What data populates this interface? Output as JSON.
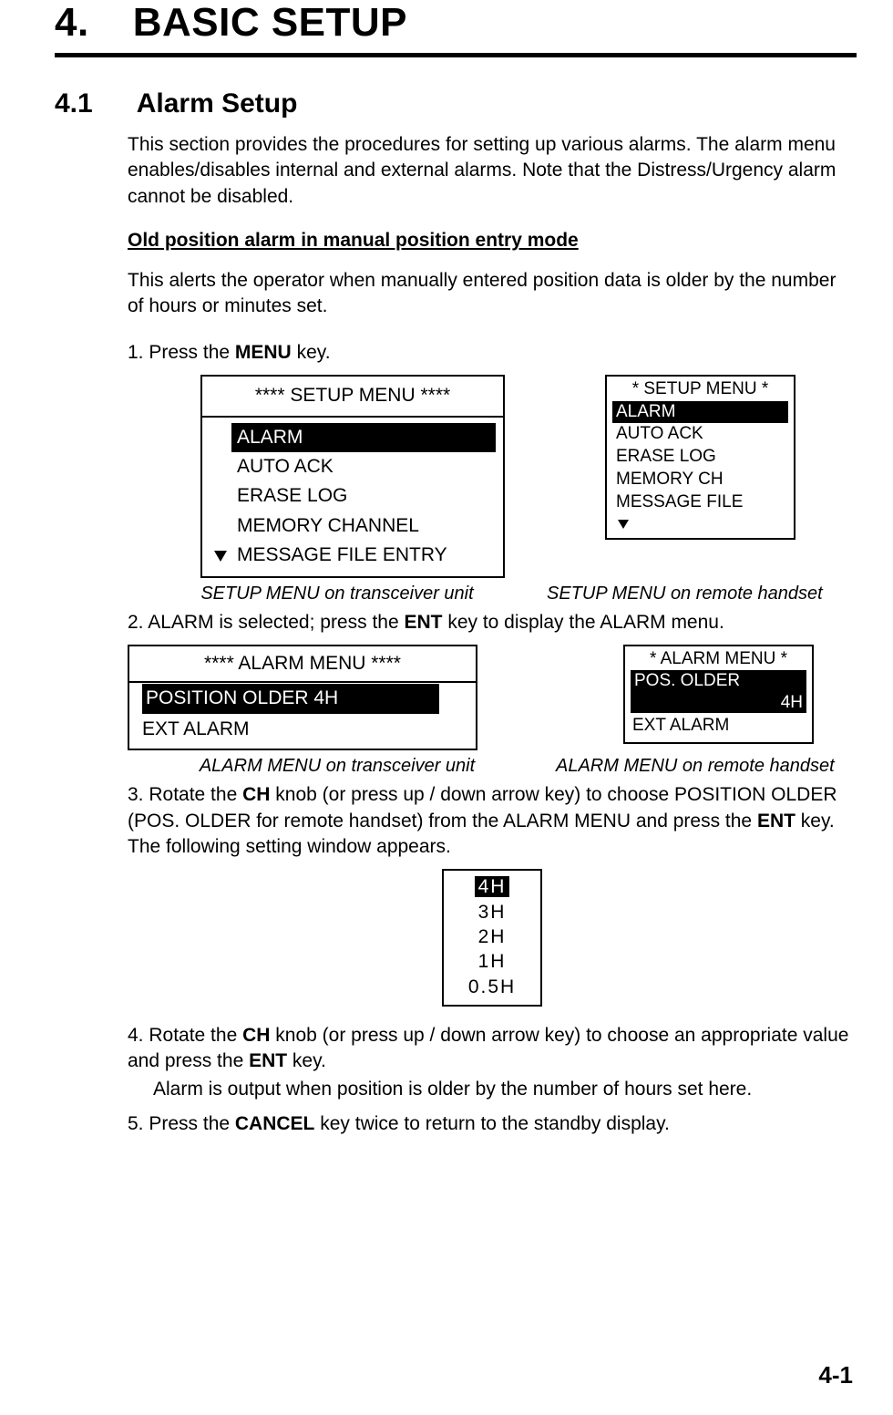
{
  "chapter": {
    "num": "4.",
    "title": "BASIC SETUP"
  },
  "section": {
    "num": "4.1",
    "title": "Alarm Setup"
  },
  "intro": "This section provides the procedures for setting up various alarms. The alarm menu enables/disables internal and external alarms. Note that the Distress/Urgency alarm cannot be disabled.",
  "sub1": "Old position alarm in manual position entry mode",
  "sub1_body": "This alerts the operator when manually entered position data is older by the number of hours or minutes set.",
  "step1_a": "1. Press the ",
  "step1_b": "MENU",
  "step1_c": " key.",
  "setup_big": {
    "header": "**** SETUP MENU ****",
    "items": [
      "ALARM",
      "AUTO  ACK",
      "ERASE  LOG",
      "MEMORY CHANNEL",
      "MESSAGE FILE ENTRY"
    ]
  },
  "setup_small": {
    "header": "* SETUP MENU *",
    "items": [
      "ALARM",
      "AUTO  ACK",
      "ERASE  LOG",
      "MEMORY CH",
      "MESSAGE FILE"
    ]
  },
  "caption1_left": "SETUP MENU on transceiver unit",
  "caption1_right": "SETUP MENU on remote handset",
  "step2_a": "2. ALARM is selected; press the ",
  "step2_b": "ENT",
  "step2_c": " key to display the ALARM menu.",
  "alarm_big": {
    "header": "**** ALARM MENU ****",
    "row1": "POSITION  OLDER   4H",
    "row2": "EXT ALARM"
  },
  "alarm_small": {
    "header": "* ALARM MENU *",
    "row1a": "POS. OLDER",
    "row1b": "4H",
    "row2": "EXT ALARM"
  },
  "caption2_left": "ALARM MENU on transceiver unit",
  "caption2_right": "ALARM MENU on remote handset",
  "step3_a": "3. Rotate the ",
  "step3_b": "CH",
  "step3_c": " knob (or press up / down arrow key) to choose POSITION OLDER (POS. OLDER for remote handset) from the ALARM MENU and press the ",
  "step3_d": "ENT",
  "step3_e": " key. The following setting window appears.",
  "hours": [
    "4H",
    "3H",
    "2H",
    "1H",
    "0.5H"
  ],
  "step4_a": "4. Rotate the ",
  "step4_b": "CH",
  "step4_c": " knob (or press up / down arrow key) to choose an appropriate value and press the ",
  "step4_d": "ENT",
  "step4_e": " key.",
  "step4_note": "Alarm is output when position is older by the number of hours set here.",
  "step5_a": "5. Press the ",
  "step5_b": "CANCEL",
  "step5_c": " key twice to return to the standby display.",
  "pagenum": "4-1"
}
